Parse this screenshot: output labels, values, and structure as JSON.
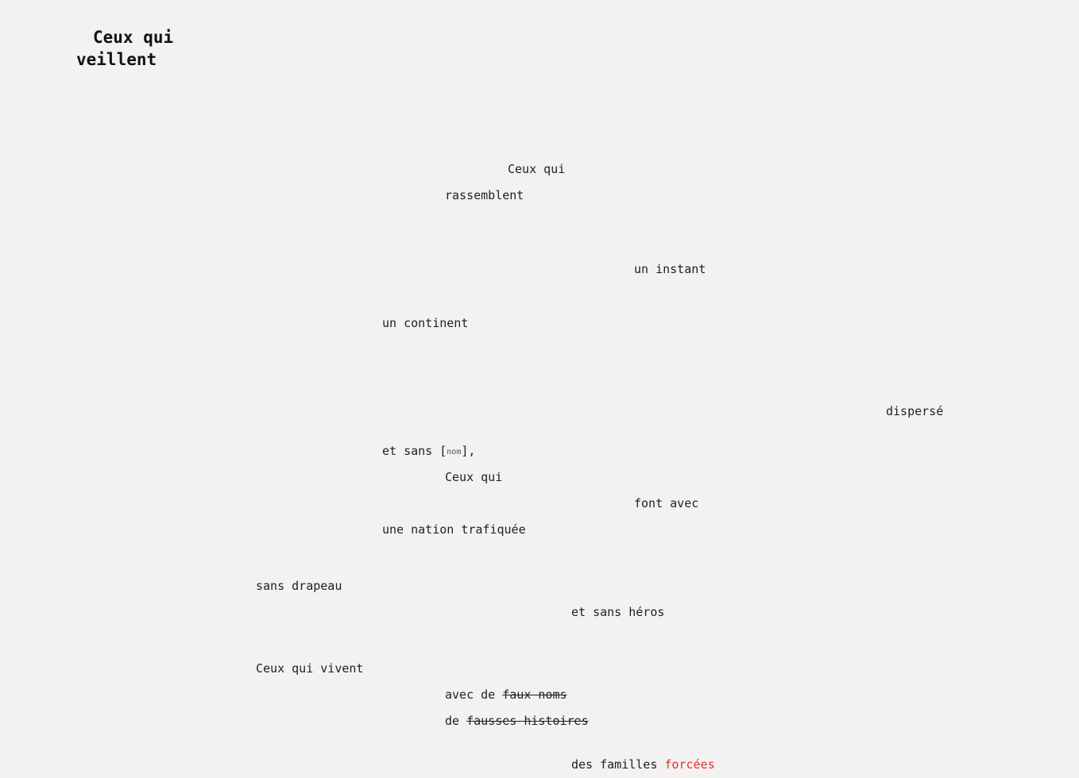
{
  "title": {
    "line1": "Ceux qui",
    "line2": "veillent"
  },
  "poem": {
    "l1": "Ceux qui",
    "l2": "rassemblent",
    "l3": "un instant",
    "l4": "un continent",
    "l5": "dispersé",
    "l6_pre": "et sans [",
    "l6_small": "nom",
    "l6_post": "],",
    "l7": "Ceux qui",
    "l8": "font avec",
    "l9": "une nation trafiquée",
    "l10": "sans drapeau",
    "l11": "et sans héros",
    "l12": "Ceux qui vivent",
    "l13_pre": "avec de ",
    "l13_strike": "faux noms",
    "l14_pre": "de ",
    "l14_strike": "fausses histoires",
    "l15_pre": "des familles ",
    "l15_red": "forcées"
  },
  "colors": {
    "background": "#f3f2f0",
    "text": "#1f1f1f",
    "accent": "#e0322b"
  }
}
